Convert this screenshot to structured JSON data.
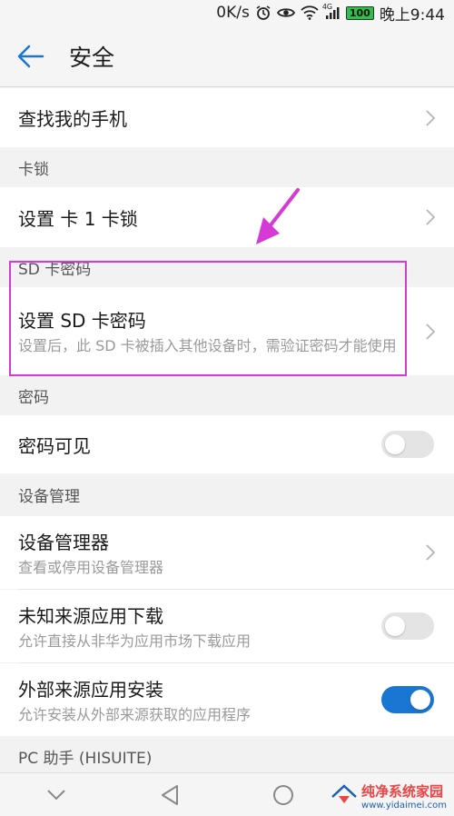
{
  "status": {
    "speed": "0K/s",
    "net_label": "4G",
    "battery": "100",
    "time": "晚上9:44"
  },
  "appbar": {
    "title": "安全"
  },
  "rows": {
    "find_phone": "查找我的手机",
    "sec_card_lock": "卡锁",
    "card_lock": "设置 卡 1 卡锁",
    "sec_sd": "SD 卡密码",
    "sd_title": "设置 SD 卡密码",
    "sd_sub": "设置后，此 SD 卡被插入其他设备时，需验证密码才能使用",
    "sec_password": "密码",
    "password_visible": "密码可见",
    "sec_device": "设备管理",
    "device_admin": "设备管理器",
    "device_admin_sub": "查看或停用设备管理器",
    "unknown_source": "未知来源应用下载",
    "unknown_source_sub": "允许直接从非华为应用市场下载应用",
    "external_install": "外部来源应用安装",
    "external_install_sub": "允许安装从外部来源获取的应用程序",
    "sec_pc": "PC 助手 (HISUITE)"
  },
  "toggles": {
    "password_visible": false,
    "unknown_source": false,
    "external_install": true
  },
  "colors": {
    "accent": "#1976d2",
    "highlight": "#d63ad6"
  },
  "watermark": {
    "title": "纯净系统家园",
    "url": "www.yidaimei.com"
  }
}
